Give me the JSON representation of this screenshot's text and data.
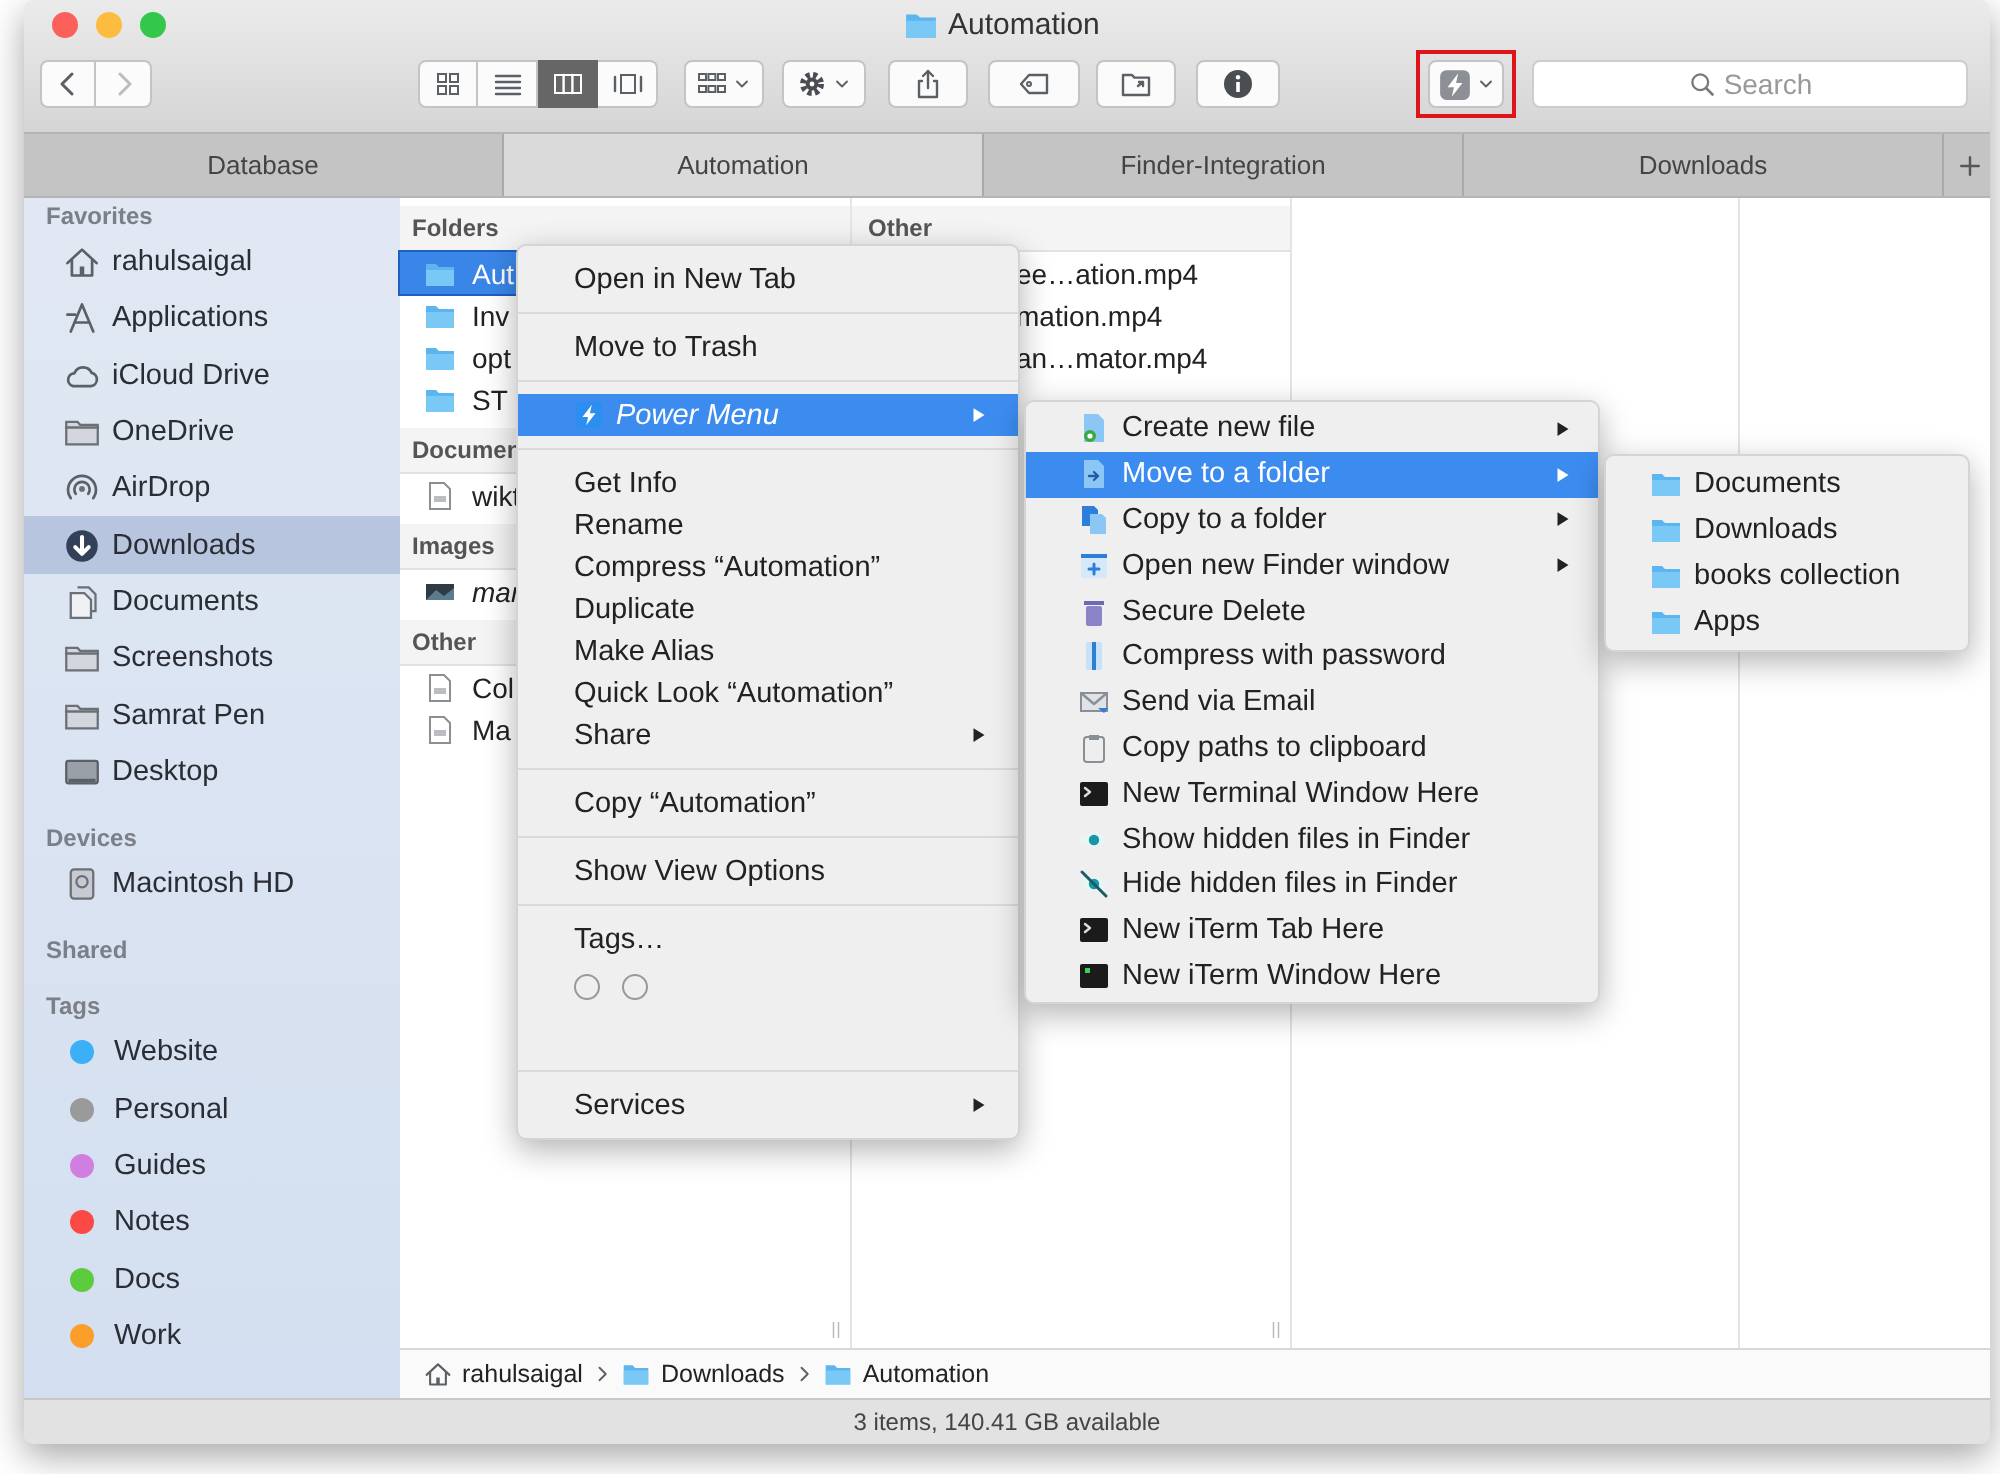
{
  "window": {
    "title": "Automation"
  },
  "toolbar": {
    "view_modes": [
      {
        "selected": false
      },
      {
        "selected": false
      },
      {
        "selected": true
      },
      {
        "selected": false
      }
    ],
    "power_button": {
      "highlighted": true
    },
    "search": {
      "placeholder": "Search"
    }
  },
  "tabs": [
    {
      "label": "Database",
      "selected": false
    },
    {
      "label": "Automation",
      "selected": true
    },
    {
      "label": "Finder-Integration",
      "selected": false
    },
    {
      "label": "Downloads",
      "selected": false
    }
  ],
  "sidebar": {
    "sections": [
      {
        "title": "Favorites",
        "items": [
          {
            "label": "rahulsaigal",
            "selected": false
          },
          {
            "label": "Applications",
            "selected": false
          },
          {
            "label": "iCloud Drive",
            "selected": false
          },
          {
            "label": "OneDrive",
            "selected": false
          },
          {
            "label": "AirDrop",
            "selected": false
          },
          {
            "label": "Downloads",
            "selected": true
          },
          {
            "label": "Documents",
            "selected": false
          },
          {
            "label": "Screenshots",
            "selected": false
          },
          {
            "label": "Samrat Pen",
            "selected": false
          },
          {
            "label": "Desktop",
            "selected": false
          }
        ]
      },
      {
        "title": "Devices",
        "items": [
          {
            "label": "Macintosh HD",
            "selected": false
          }
        ]
      },
      {
        "title": "Shared"
      },
      {
        "title": "Tags",
        "items": [
          {
            "label": "Website",
            "color": "#3bb0f6"
          },
          {
            "label": "Personal",
            "color": "#9a9a9a"
          },
          {
            "label": "Guides",
            "color": "#d27ee0"
          },
          {
            "label": "Notes",
            "color": "#fb4a45"
          },
          {
            "label": "Docs",
            "color": "#5ccb3e"
          },
          {
            "label": "Work",
            "color": "#fb9f2a"
          }
        ]
      }
    ]
  },
  "columns": [
    {
      "sections": [
        {
          "title": "Folders",
          "rows": [
            {
              "name": "Aut",
              "selected": true
            },
            {
              "name": "Inv",
              "selected": false
            },
            {
              "name": "opt",
              "selected": false
            },
            {
              "name": "ST",
              "selected": false
            }
          ]
        },
        {
          "title": "Documen",
          "rows": [
            {
              "name": "wikt",
              "selected": false
            }
          ]
        },
        {
          "title": "Images",
          "rows": [
            {
              "name": "mar",
              "selected": false
            }
          ]
        },
        {
          "title": "Other",
          "rows": [
            {
              "name": "Col",
              "selected": false
            },
            {
              "name": "Ma",
              "selected": false
            }
          ]
        }
      ]
    },
    {
      "sections": [
        {
          "title": "Other",
          "rows": [
            {
              "name": "ee…ation.mp4",
              "selected": false
            },
            {
              "name": "mation.mp4",
              "selected": false
            },
            {
              "name": "an…mator.mp4",
              "selected": false
            }
          ]
        }
      ]
    }
  ],
  "path": [
    "rahulsaigal",
    "Downloads",
    "Automation"
  ],
  "status": "3 items, 140.41 GB available",
  "context_menu": {
    "groups": [
      {
        "items": [
          {
            "label": "Open in New Tab",
            "selected": false,
            "submenu": false
          }
        ]
      },
      {
        "items": [
          {
            "label": "Move to Trash",
            "selected": false,
            "submenu": false
          }
        ]
      },
      {
        "plugin": true,
        "items": [
          {
            "label": "Power Menu",
            "selected": true,
            "submenu": true
          }
        ]
      },
      {
        "items": [
          {
            "label": "Get Info",
            "selected": false,
            "submenu": false
          },
          {
            "label": "Rename",
            "selected": false,
            "submenu": false
          },
          {
            "label": "Compress “Automation”",
            "selected": false,
            "submenu": false
          },
          {
            "label": "Duplicate",
            "selected": false,
            "submenu": false
          },
          {
            "label": "Make Alias",
            "selected": false,
            "submenu": false
          },
          {
            "label": "Quick Look “Automation”",
            "selected": false,
            "submenu": false
          },
          {
            "label": "Share",
            "selected": false,
            "submenu": true
          }
        ]
      },
      {
        "items": [
          {
            "label": "Copy “Automation”",
            "selected": false,
            "submenu": false
          }
        ]
      },
      {
        "items": [
          {
            "label": "Show View Options",
            "selected": false,
            "submenu": false
          }
        ]
      },
      {
        "tag_picker": true,
        "items": [
          {
            "label": "Tags…",
            "selected": false,
            "submenu": false
          }
        ]
      },
      {
        "items": [
          {
            "label": "Services",
            "selected": false,
            "submenu": true
          }
        ]
      }
    ]
  },
  "power_menu": {
    "items": [
      {
        "label": "Create new file",
        "selected": false,
        "submenu": true
      },
      {
        "label": "Move to a folder",
        "selected": true,
        "submenu": true
      },
      {
        "label": "Copy to a folder",
        "selected": false,
        "submenu": true
      },
      {
        "label": "Open new Finder window",
        "selected": false,
        "submenu": true
      },
      {
        "label": "Secure Delete",
        "selected": false,
        "submenu": false
      },
      {
        "label": "Compress with password",
        "selected": false,
        "submenu": false
      },
      {
        "label": "Send via Email",
        "selected": false,
        "submenu": false
      },
      {
        "label": "Copy paths to clipboard",
        "selected": false,
        "submenu": false
      },
      {
        "label": "New Terminal Window Here",
        "selected": false,
        "submenu": false
      },
      {
        "label": "Show hidden files in Finder",
        "selected": false,
        "submenu": false
      },
      {
        "label": "Hide hidden files in Finder",
        "selected": false,
        "submenu": false
      },
      {
        "label": "New iTerm Tab Here",
        "selected": false,
        "submenu": false
      },
      {
        "label": "New iTerm Window Here",
        "selected": false,
        "submenu": false
      }
    ]
  },
  "folder_menu": {
    "items": [
      {
        "label": "Documents",
        "selected": false
      },
      {
        "label": "Downloads",
        "selected": false
      },
      {
        "label": "books collection",
        "selected": false
      },
      {
        "label": "Apps",
        "selected": false
      }
    ]
  }
}
